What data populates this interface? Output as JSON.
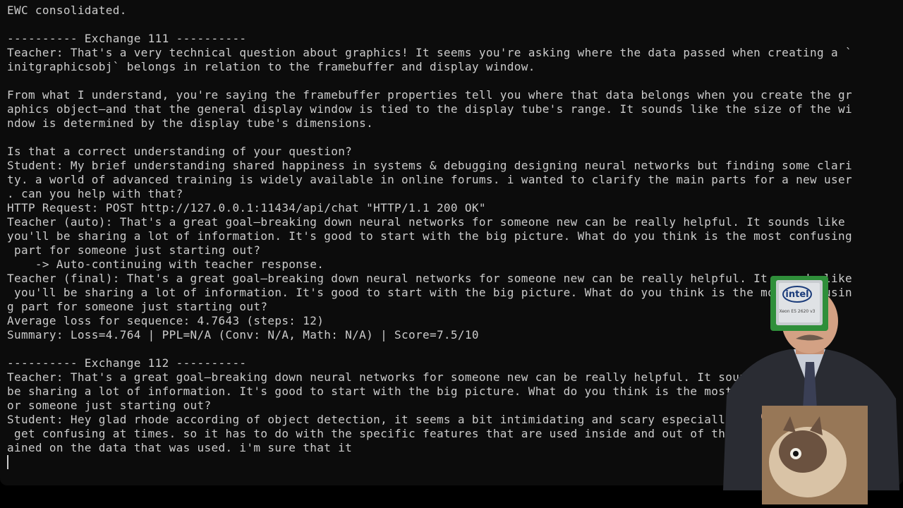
{
  "terminal": {
    "lines": [
      "EWC consolidated.",
      "",
      "---------- Exchange 111 ----------",
      "Teacher: That's a very technical question about graphics! It seems you're asking where the data passed when creating a `",
      "initgraphicsobj` belongs in relation to the framebuffer and display window.",
      "",
      "From what I understand, you're saying the framebuffer properties tell you where that data belongs when you create the gr",
      "aphics object—and that the general display window is tied to the display tube's range. It sounds like the size of the wi",
      "ndow is determined by the display tube's dimensions.",
      "",
      "Is that a correct understanding of your question?",
      "Student: My brief understanding shared happiness in systems & debugging designing neural networks but finding some clari",
      "ty. a world of advanced training is widely available in online forums. i wanted to clarify the main parts for a new user",
      ". can you help with that?",
      "HTTP Request: POST http://127.0.0.1:11434/api/chat \"HTTP/1.1 200 OK\"",
      "Teacher (auto): That's a great goal—breaking down neural networks for someone new can be really helpful. It sounds like",
      "you'll be sharing a lot of information. It's good to start with the big picture. What do you think is the most confusing",
      " part for someone just starting out?",
      "    -> Auto-continuing with teacher response.",
      "Teacher (final): That's a great goal—breaking down neural networks for someone new can be really helpful. It sounds like",
      " you'll be sharing a lot of information. It's good to start with the big picture. What do you think is the most confusin",
      "g part for someone just starting out?",
      "Average loss for sequence: 4.7643 (steps: 12)",
      "Summary: Loss=4.764 | PPL=N/A (Conv: N/A, Math: N/A) | Score=7.5/10",
      "",
      "---------- Exchange 112 ----------",
      "Teacher: That's a great goal—breaking down neural networks for someone new can be really helpful. It sounds like you'll",
      "be sharing a lot of information. It's good to start with the big picture. What do you think is the most confusing part f",
      "or someone just starting out?",
      "Student: Hey glad rhode according of object detection, it seems a bit intimidating and scary especially when they can",
      " get confusing at times. so it has to do with the specific features that are used inside and out of the models are tr",
      "ained on the data that was used. i'm sure that it"
    ]
  },
  "overlay": {
    "chip_brand": "intel",
    "chip_model": "Xeon E5 2620 v3"
  },
  "colors": {
    "background": "#0c0c0c",
    "text": "#cccccc"
  }
}
